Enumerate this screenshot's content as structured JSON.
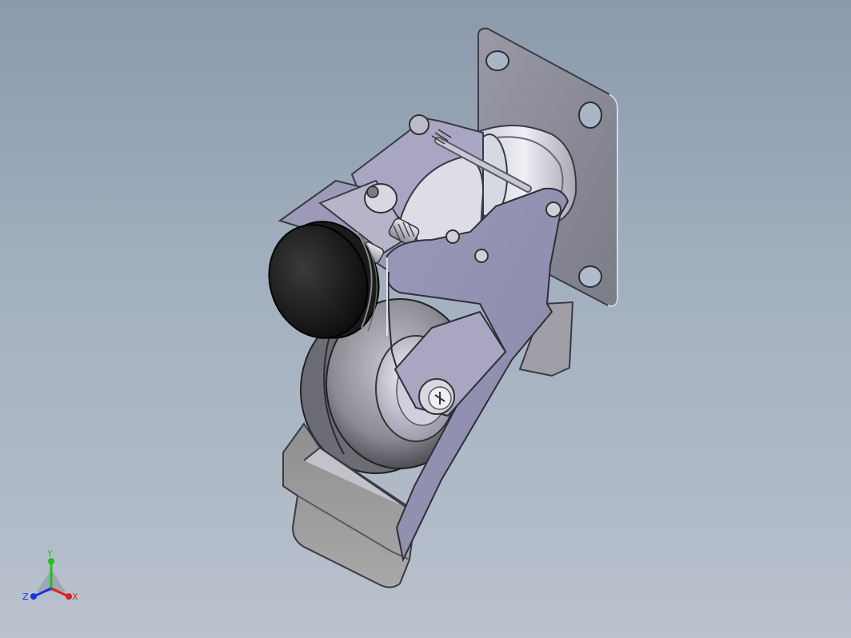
{
  "viewport": {
    "background_top": "#8a9aac",
    "background_bottom": "#b9c2cd"
  },
  "model": {
    "icon": "swivel-caster-with-foot-brake-3d-model"
  },
  "triad": {
    "x_label": "X",
    "y_label": "Y",
    "z_label": "Z",
    "x_color": "#e02020",
    "y_color": "#20c020",
    "z_color": "#2030e0"
  }
}
